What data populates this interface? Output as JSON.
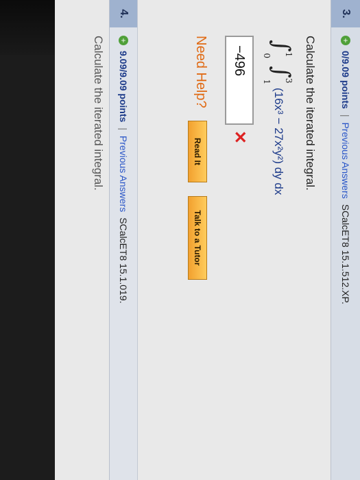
{
  "q3": {
    "number": "3.",
    "points": "0/9.09 points",
    "separator": "|",
    "previous_answers": "Previous Answers",
    "source": "SCalcET8 15.1.512.XP.",
    "prompt": "Calculate the iterated integral.",
    "outer_limits": {
      "upper": "1",
      "lower": "0"
    },
    "inner_limits": {
      "upper": "3",
      "lower": "1"
    },
    "integrand": "(16x³ − 27x²y²) dy dx",
    "answer_value": "−496",
    "need_help": "Need Help?",
    "read_it": "Read It",
    "talk_tutor": "Talk to a Tutor"
  },
  "q4": {
    "number": "4.",
    "points": "9.09/9.09 points",
    "separator": "|",
    "previous_answers": "Previous Answers",
    "source": "SCalcET8 15.1.019.",
    "prompt": "Calculate the iterated integral."
  },
  "icons": {
    "plus": "plus-icon",
    "wrong": "x-icon"
  }
}
